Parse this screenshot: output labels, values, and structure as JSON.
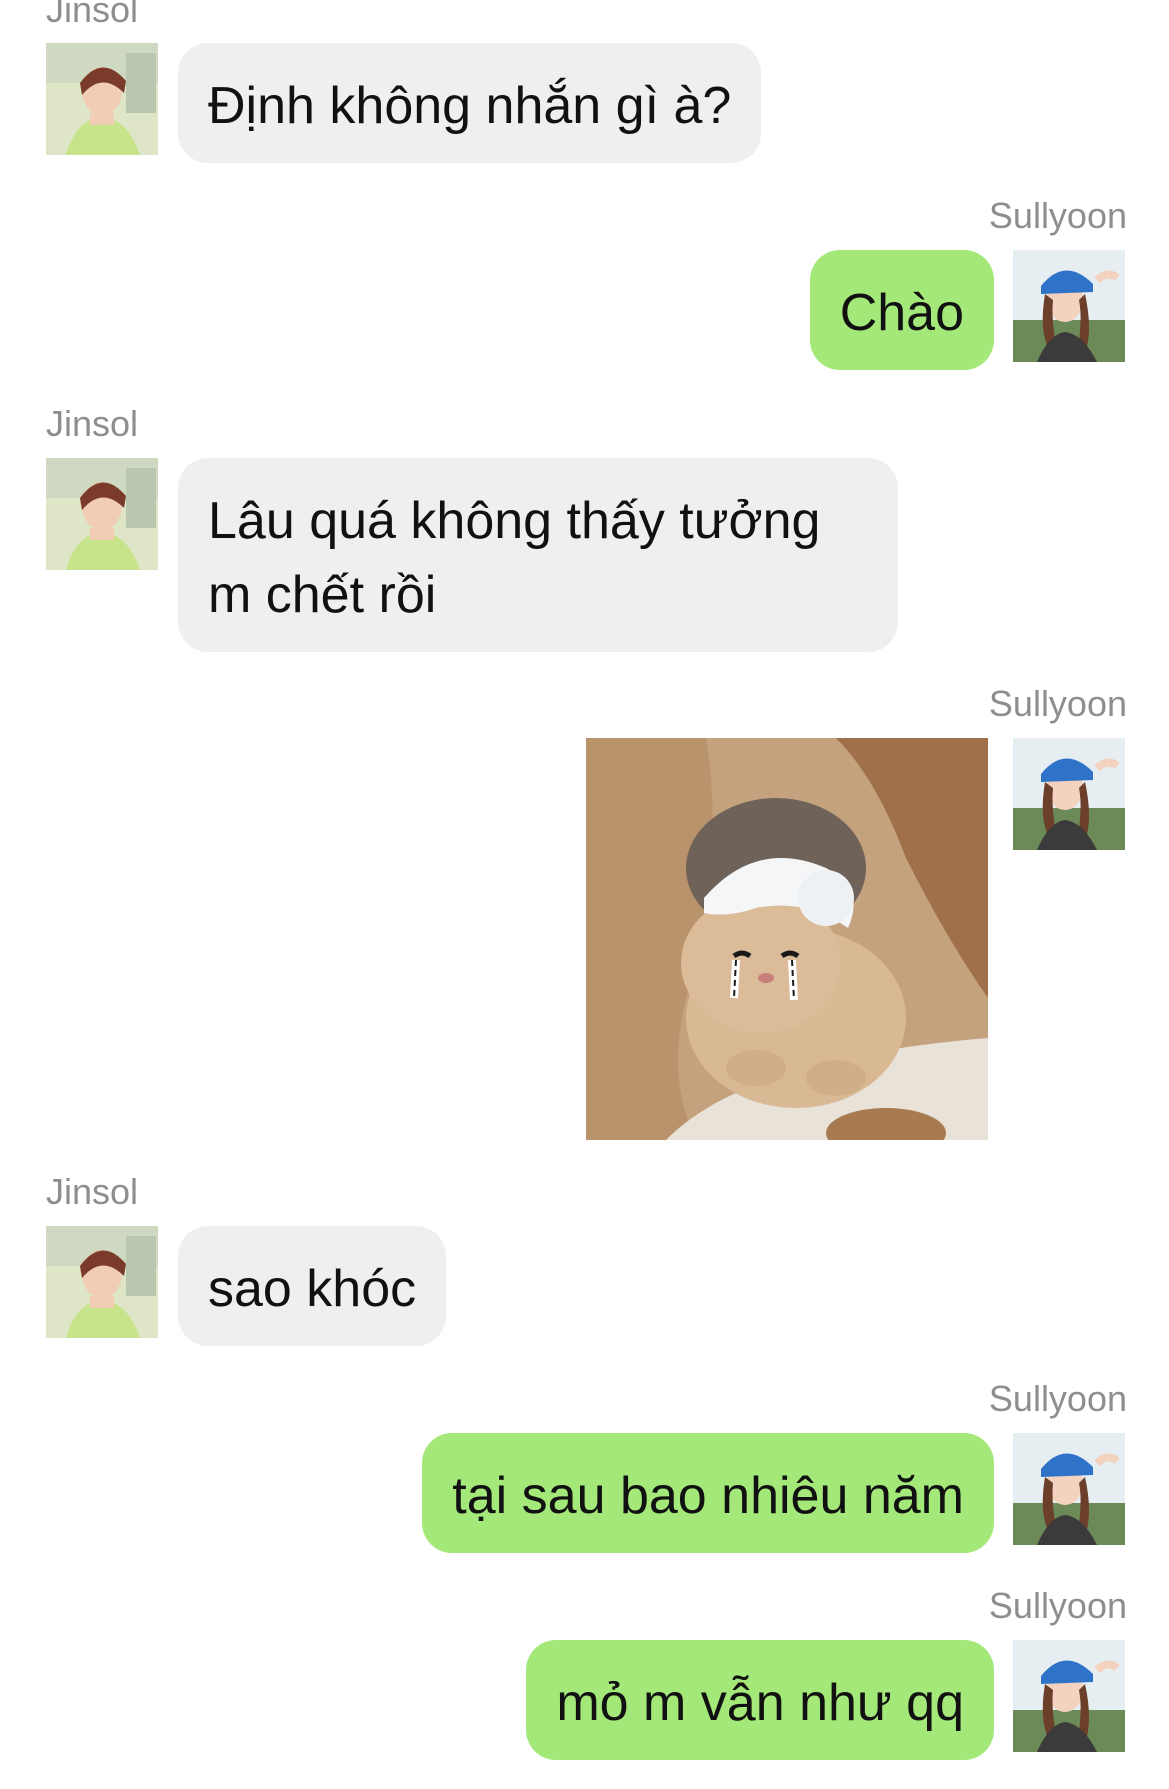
{
  "messages": [
    {
      "sender": "Jinsol",
      "type": "text",
      "text": "Định không nhắn gì à?"
    },
    {
      "sender": "Sullyoon",
      "type": "text",
      "text": "Chào"
    },
    {
      "sender": "Jinsol",
      "type": "text",
      "text": "Lâu quá không thấy tưởng m chết rồi"
    },
    {
      "sender": "Sullyoon",
      "type": "image",
      "image_description": "crying-kitten-sticker"
    },
    {
      "sender": "Jinsol",
      "type": "text",
      "text": "sao khóc"
    },
    {
      "sender": "Sullyoon",
      "type": "text",
      "text": "tại sau bao nhiêu năm"
    },
    {
      "sender": "Sullyoon",
      "type": "text",
      "text": "mỏ m vẫn như qq"
    }
  ],
  "colors": {
    "incoming_bubble": "#efefef",
    "outgoing_bubble": "#a3e879",
    "sender_name": "#8e8e8e",
    "text": "#111111"
  }
}
